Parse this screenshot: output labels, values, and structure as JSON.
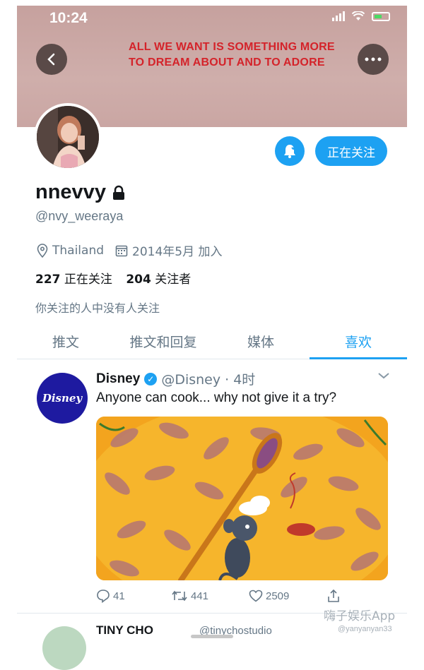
{
  "status_bar": {
    "time": "10:24"
  },
  "banner": {
    "line1": "ALL WE WANT IS SOMETHING MORE",
    "line2": "TO DREAM ABOUT AND TO ADORE"
  },
  "profile": {
    "name": "nnevvy",
    "handle": "@nvy_weeraya",
    "location": "Thailand",
    "joined": "2014年5月 加入",
    "following_count": "227",
    "following_label": "正在关注",
    "followers_count": "204",
    "followers_label": "关注者",
    "mutual_note": "你关注的人中没有人关注",
    "follow_button": "正在关注"
  },
  "tabs": [
    {
      "label": "推文",
      "active": false
    },
    {
      "label": "推文和回复",
      "active": false
    },
    {
      "label": "媒体",
      "active": false
    },
    {
      "label": "喜欢",
      "active": true
    }
  ],
  "tweet": {
    "avatar_text": "Disney",
    "display_name": "Disney",
    "handle_time": "@Disney · 4时",
    "text": "Anyone can cook... why not give it a try?",
    "replies": "41",
    "retweets": "441",
    "likes": "2509"
  },
  "next_tweet": {
    "display_name": "TINY CHO",
    "handle": "@tinychostudio"
  },
  "watermark": {
    "app": "嗨子娱乐App",
    "user": "@yanyanyan33"
  },
  "colors": {
    "accent": "#1da1f2",
    "banner": "#c9a4a2",
    "banner_text": "#d4232a",
    "disney_blue": "#1e1aa0"
  }
}
